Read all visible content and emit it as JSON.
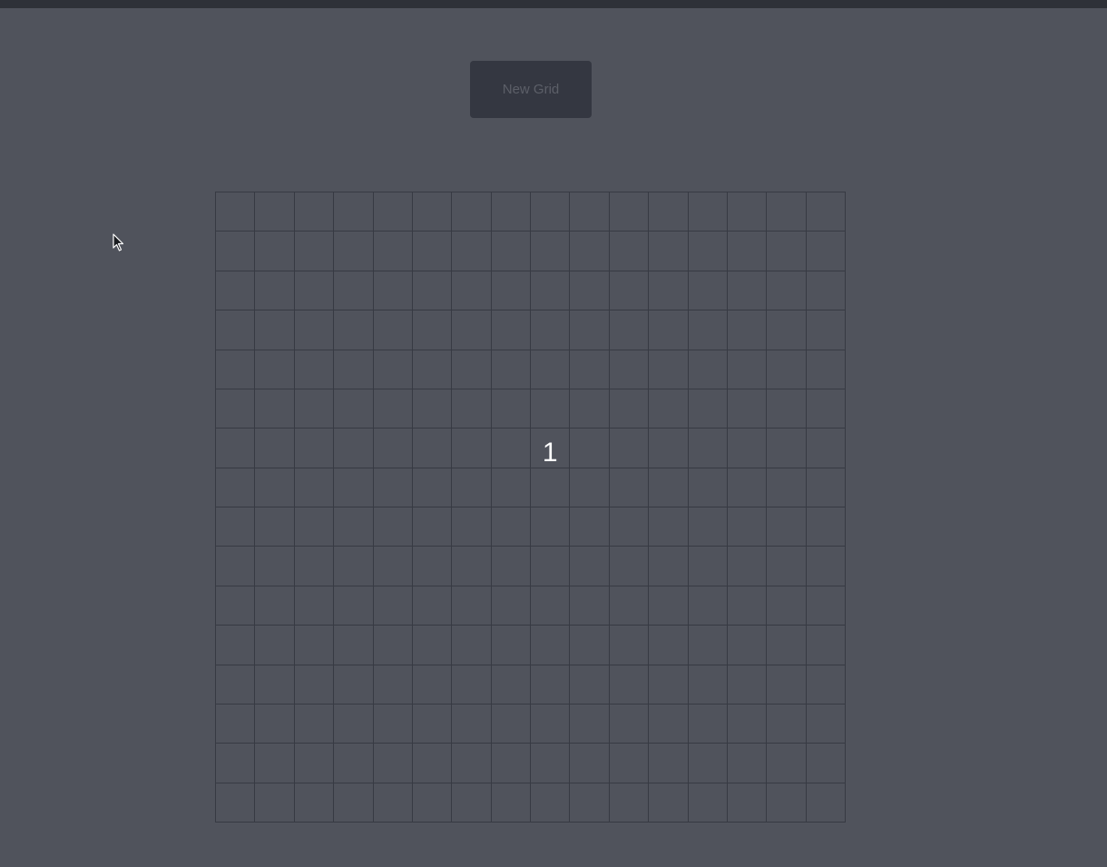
{
  "toolbar": {
    "new_grid_label": "New Grid"
  },
  "grid": {
    "rows": 16,
    "cols": 16,
    "labels": [
      {
        "row": 6,
        "col": 8,
        "text": "1"
      }
    ]
  },
  "colors": {
    "background": "#50535c",
    "button_bg": "#343741",
    "button_text": "#5c5f68",
    "grid_line": "#373a43",
    "label_text": "#ffffff"
  },
  "icons": {
    "cursor": "mouse-pointer-icon"
  }
}
